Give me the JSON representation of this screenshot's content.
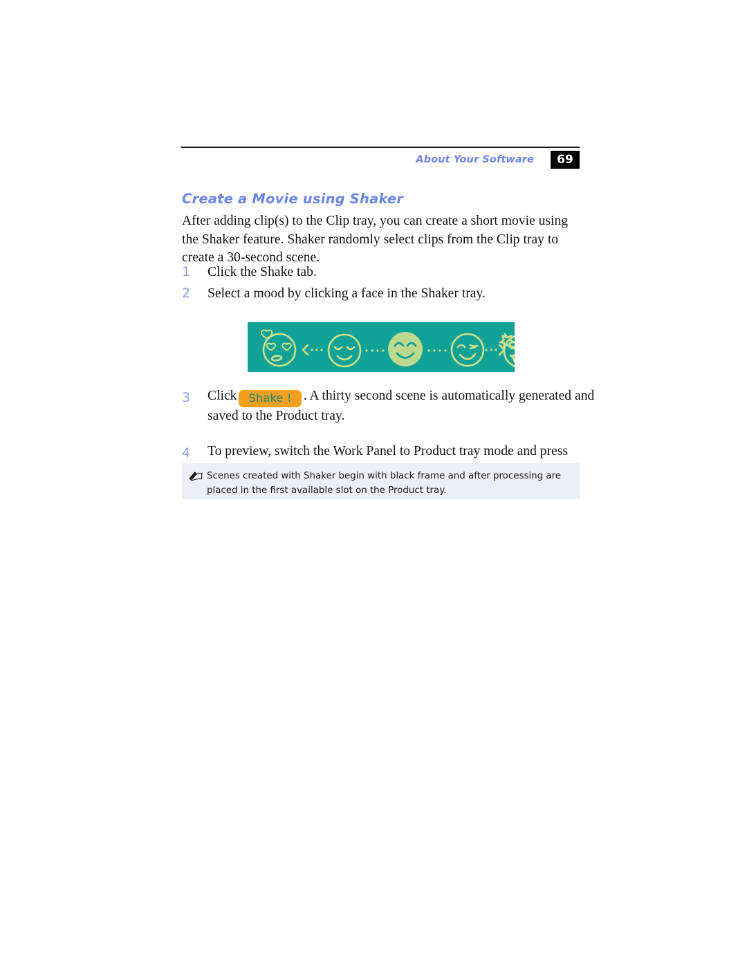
{
  "header": {
    "title": "About Your Software",
    "page_number": "69"
  },
  "section": {
    "heading": "Create a Movie using Shaker",
    "intro": "After adding clip(s) to the Clip tray, you can create a short movie using the Shaker feature. Shaker randomly select clips from the Clip tray to create a 30-second scene."
  },
  "steps": [
    {
      "number": "1",
      "text": "Click the Shake tab."
    },
    {
      "number": "2",
      "text": "Select a mood by clicking a face in the Shaker tray."
    },
    {
      "number": "3",
      "text_before": "Click",
      "button_label": "Shake !",
      "text_after": ". A thirty second scene is automatically generated and saved to the Product tray."
    },
    {
      "number": "4",
      "text": "To preview, switch the Work Panel to Product tray mode and press play."
    }
  ],
  "figure": {
    "name": "shaker-mood-tray",
    "background_color": "#11a297",
    "stroke_color": "#cfe08a",
    "selected_fill_color": "#bcd98e",
    "faces": [
      {
        "name": "face-in-love",
        "selected": false
      },
      {
        "name": "face-relaxed",
        "selected": false
      },
      {
        "name": "face-happy",
        "selected": true
      },
      {
        "name": "face-winking",
        "selected": false
      },
      {
        "name": "face-excited",
        "selected": false
      }
    ],
    "connectors": [
      "arrow-left",
      "dots",
      "dots",
      "arrow-right"
    ]
  },
  "note": {
    "icon": "pencil-note-icon",
    "text": "Scenes created with Shaker begin with black frame and after processing are placed in the first available slot on the Product tray.",
    "background_color": "#eceffa"
  },
  "colors": {
    "accent_blue": "#6b86e8",
    "step_number_blue": "#8aa0ef",
    "button_orange": "#f2a01e",
    "button_text_teal": "#14857c",
    "tray_teal": "#11a297"
  }
}
